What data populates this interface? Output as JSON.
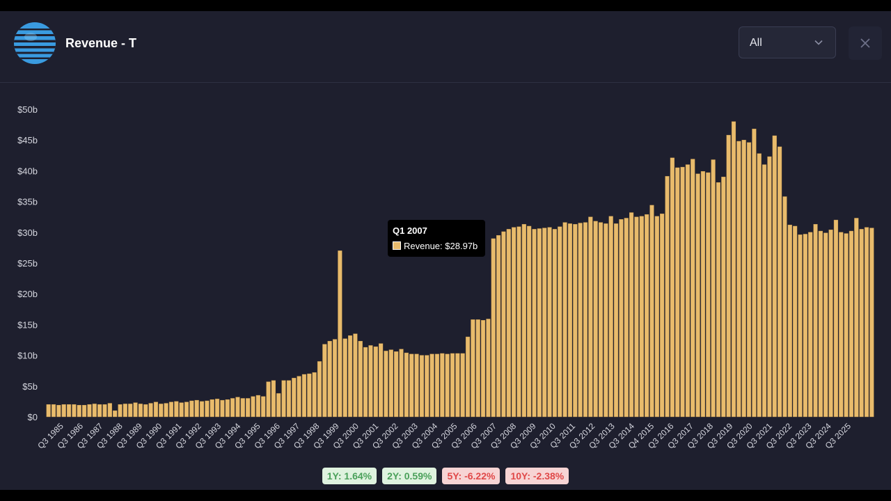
{
  "header": {
    "title": "Revenue - T",
    "logo_icon": "att-globe-logo",
    "period_select": {
      "value": "All",
      "options_visible": [
        "All"
      ]
    },
    "close_icon": "close-icon"
  },
  "colors": {
    "background": "#1e1f2e",
    "bar": "#e8bb6c",
    "bar_edge": "#c99a4e",
    "axis_text": "#d6d7df",
    "badge_positive_bg": "#dff2df",
    "badge_positive_text": "#4aa05a",
    "badge_negative_bg": "#f7d4d4",
    "badge_negative_text": "#e04848"
  },
  "tooltip": {
    "title": "Q1 2007",
    "series": "Revenue",
    "value": "$28.97b",
    "label": "Revenue: $28.97b"
  },
  "growth_badges": [
    {
      "label": "1Y: 1.64%",
      "sign": "pos"
    },
    {
      "label": "2Y: 0.59%",
      "sign": "pos"
    },
    {
      "label": "5Y: -6.22%",
      "sign": "neg"
    },
    {
      "label": "10Y: -2.38%",
      "sign": "neg"
    }
  ],
  "chart_data": {
    "type": "bar",
    "title": "Revenue - T",
    "xlabel": "",
    "ylabel": "",
    "ylim": [
      0,
      50
    ],
    "y_unit": "billions USD",
    "y_ticks": [
      "$0",
      "$5b",
      "$10b",
      "$15b",
      "$20b",
      "$25b",
      "$30b",
      "$35b",
      "$40b",
      "$45b",
      "$50b"
    ],
    "grid": false,
    "legend": "none",
    "x_tick_labels": [
      "Q3 1985",
      "Q3 1986",
      "Q3 1987",
      "Q3 1988",
      "Q3 1989",
      "Q3 1990",
      "Q3 1991",
      "Q3 1992",
      "Q3 1993",
      "Q3 1994",
      "Q3 1995",
      "Q3 1996",
      "Q3 1997",
      "Q3 1998",
      "Q3 1999",
      "Q3 2000",
      "Q3 2001",
      "Q3 2002",
      "Q3 2003",
      "Q3 2004",
      "Q3 2005",
      "Q3 2006",
      "Q3 2007",
      "Q3 2008",
      "Q3 2009",
      "Q3 2010",
      "Q3 2011",
      "Q3 2012",
      "Q3 2013",
      "Q3 2014",
      "Q4 2015",
      "Q3 2016",
      "Q3 2017",
      "Q3 2018",
      "Q3 2019",
      "Q3 2020",
      "Q3 2021",
      "Q3 2022",
      "Q3 2023",
      "Q3 2024",
      "Q3 2025"
    ],
    "series": [
      {
        "name": "Revenue",
        "values": [
          2.0,
          2.0,
          1.9,
          2.0,
          2.0,
          2.0,
          1.9,
          1.9,
          2.0,
          2.1,
          2.0,
          2.0,
          2.2,
          1.0,
          2.0,
          2.1,
          2.1,
          2.3,
          2.1,
          2.0,
          2.2,
          2.4,
          2.1,
          2.2,
          2.4,
          2.5,
          2.3,
          2.4,
          2.6,
          2.7,
          2.5,
          2.6,
          2.8,
          2.9,
          2.7,
          2.8,
          3.0,
          3.2,
          3.0,
          3.0,
          3.3,
          3.5,
          3.3,
          5.7,
          5.9,
          3.8,
          5.9,
          5.9,
          6.3,
          6.6,
          6.9,
          7.0,
          7.2,
          9.0,
          11.8,
          12.3,
          12.6,
          27.0,
          12.7,
          13.2,
          13.5,
          12.3,
          11.3,
          11.6,
          11.4,
          11.9,
          10.7,
          10.9,
          10.6,
          11.0,
          10.4,
          10.2,
          10.2,
          10.0,
          10.0,
          10.2,
          10.2,
          10.3,
          10.2,
          10.3,
          10.3,
          10.3,
          13.0,
          15.8,
          15.8,
          15.7,
          15.9,
          28.97,
          29.5,
          30.1,
          30.5,
          30.8,
          30.9,
          31.3,
          31.0,
          30.5,
          30.6,
          30.7,
          30.8,
          30.5,
          30.9,
          31.6,
          31.4,
          31.3,
          31.5,
          31.6,
          32.5,
          31.8,
          31.6,
          31.4,
          32.6,
          31.4,
          32.1,
          32.3,
          33.2,
          32.5,
          32.6,
          32.9,
          34.4,
          32.6,
          33.0,
          39.1,
          42.1,
          40.5,
          40.6,
          41.0,
          41.9,
          39.5,
          39.9,
          39.7,
          41.8,
          38.1,
          39.0,
          45.8,
          48.0,
          44.8,
          45.0,
          44.6,
          46.8,
          42.8,
          41.0,
          42.3,
          45.7,
          43.9,
          35.8,
          31.2,
          31.0,
          29.6,
          29.7,
          30.0,
          31.3,
          30.2,
          29.9,
          30.4,
          32.0,
          30.0,
          29.8,
          30.2,
          32.3,
          30.5,
          30.8,
          30.7
        ]
      }
    ]
  }
}
